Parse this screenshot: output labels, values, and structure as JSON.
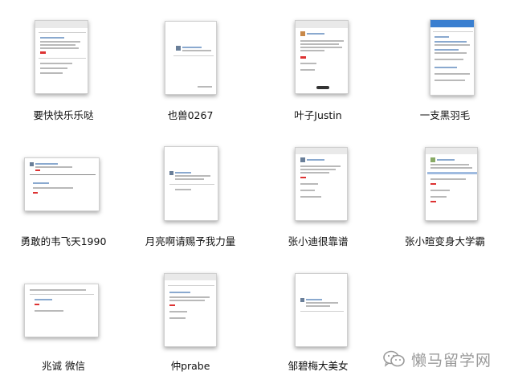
{
  "items": [
    {
      "label": "要快快乐乐哒"
    },
    {
      "label": "也兽0267"
    },
    {
      "label": "叶子Justin"
    },
    {
      "label": "一支黑羽毛"
    },
    {
      "label": "勇敢的韦飞天1990"
    },
    {
      "label": "月亮啊请赐予我力量"
    },
    {
      "label": "张小迪很靠谱"
    },
    {
      "label": "张小暄变身大学霸"
    },
    {
      "label": "兆诚 微信"
    },
    {
      "label": "仲prabe"
    },
    {
      "label": "邹碧梅大美女"
    }
  ],
  "watermark": {
    "text": "懒马留学网"
  },
  "colors": {
    "accent_red": "#dd3333",
    "accent_blue": "#3a7fd0",
    "watermark": "#9a9a9a"
  }
}
